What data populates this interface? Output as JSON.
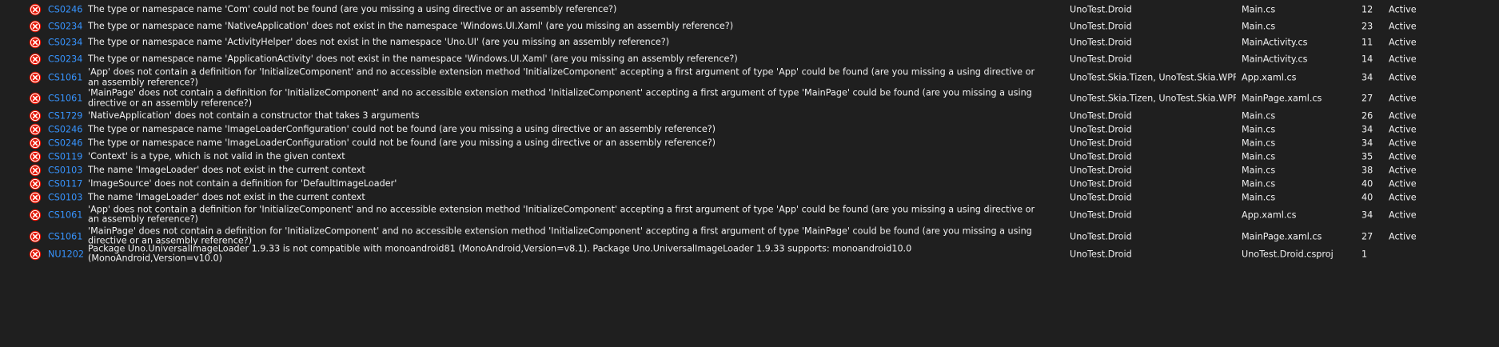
{
  "colors": {
    "background": "#1f1f1f",
    "text": "#f1f1f1",
    "link": "#3794ff",
    "error_icon": "#e51400"
  },
  "icons": {
    "error": "error-circle-icon"
  },
  "rows": [
    {
      "code": "CS0246",
      "description": "The type or namespace name 'Com' could not be found (are you missing a using directive or an assembly reference?)",
      "project": "UnoTest.Droid",
      "file": "Main.cs",
      "line": "12",
      "suppression": "Active"
    },
    {
      "code": "CS0234",
      "description": "The type or namespace name 'NativeApplication' does not exist in the namespace 'Windows.UI.Xaml' (are you missing an assembly reference?)",
      "project": "UnoTest.Droid",
      "file": "Main.cs",
      "line": "23",
      "suppression": "Active"
    },
    {
      "code": "CS0234",
      "description": "The type or namespace name 'ActivityHelper' does not exist in the namespace 'Uno.UI' (are you missing an assembly reference?)",
      "project": "UnoTest.Droid",
      "file": "MainActivity.cs",
      "line": "11",
      "suppression": "Active"
    },
    {
      "code": "CS0234",
      "description": "The type or namespace name 'ApplicationActivity' does not exist in the namespace 'Windows.UI.Xaml' (are you missing an assembly reference?)",
      "project": "UnoTest.Droid",
      "file": "MainActivity.cs",
      "line": "14",
      "suppression": "Active"
    },
    {
      "code": "CS1061",
      "description": "'App' does not contain a definition for 'InitializeComponent' and no accessible extension method 'InitializeComponent' accepting a first argument of type 'App' could be found (are you missing a using directive or an assembly reference?)",
      "project": "UnoTest.Skia.Tizen, UnoTest.Skia.WPF,...",
      "file": "App.xaml.cs",
      "line": "34",
      "suppression": "Active"
    },
    {
      "code": "CS1061",
      "description": "'MainPage' does not contain a definition for 'InitializeComponent' and no accessible extension method 'InitializeComponent' accepting a first argument of type 'MainPage' could be found (are you missing a using directive or an assembly reference?)",
      "project": "UnoTest.Skia.Tizen, UnoTest.Skia.WPF,...",
      "file": "MainPage.xaml.cs",
      "line": "27",
      "suppression": "Active"
    },
    {
      "code": "CS1729",
      "description": "'NativeApplication' does not contain a constructor that takes 3 arguments",
      "project": "UnoTest.Droid",
      "file": "Main.cs",
      "line": "26",
      "suppression": "Active"
    },
    {
      "code": "CS0246",
      "description": "The type or namespace name 'ImageLoaderConfiguration' could not be found (are you missing a using directive or an assembly reference?)",
      "project": "UnoTest.Droid",
      "file": "Main.cs",
      "line": "34",
      "suppression": "Active"
    },
    {
      "code": "CS0246",
      "description": "The type or namespace name 'ImageLoaderConfiguration' could not be found (are you missing a using directive or an assembly reference?)",
      "project": "UnoTest.Droid",
      "file": "Main.cs",
      "line": "34",
      "suppression": "Active"
    },
    {
      "code": "CS0119",
      "description": "'Context' is a type, which is not valid in the given context",
      "project": "UnoTest.Droid",
      "file": "Main.cs",
      "line": "35",
      "suppression": "Active"
    },
    {
      "code": "CS0103",
      "description": "The name 'ImageLoader' does not exist in the current context",
      "project": "UnoTest.Droid",
      "file": "Main.cs",
      "line": "38",
      "suppression": "Active"
    },
    {
      "code": "CS0117",
      "description": "'ImageSource' does not contain a definition for 'DefaultImageLoader'",
      "project": "UnoTest.Droid",
      "file": "Main.cs",
      "line": "40",
      "suppression": "Active"
    },
    {
      "code": "CS0103",
      "description": "The name 'ImageLoader' does not exist in the current context",
      "project": "UnoTest.Droid",
      "file": "Main.cs",
      "line": "40",
      "suppression": "Active"
    },
    {
      "code": "CS1061",
      "description": "'App' does not contain a definition for 'InitializeComponent' and no accessible extension method 'InitializeComponent' accepting a first argument of type 'App' could be found (are you missing a using directive or an assembly reference?)",
      "project": "UnoTest.Droid",
      "file": "App.xaml.cs",
      "line": "34",
      "suppression": "Active"
    },
    {
      "code": "CS1061",
      "description": "'MainPage' does not contain a definition for 'InitializeComponent' and no accessible extension method 'InitializeComponent' accepting a first argument of type 'MainPage' could be found (are you missing a using directive or an assembly reference?)",
      "project": "UnoTest.Droid",
      "file": "MainPage.xaml.cs",
      "line": "27",
      "suppression": "Active"
    },
    {
      "code": "NU1202",
      "description": "Package Uno.UniversalImageLoader 1.9.33 is not compatible with monoandroid81 (MonoAndroid,Version=v8.1). Package Uno.UniversalImageLoader 1.9.33 supports: monoandroid10.0 (MonoAndroid,Version=v10.0)",
      "project": "UnoTest.Droid",
      "file": "UnoTest.Droid.csproj",
      "line": "1",
      "suppression": ""
    }
  ]
}
